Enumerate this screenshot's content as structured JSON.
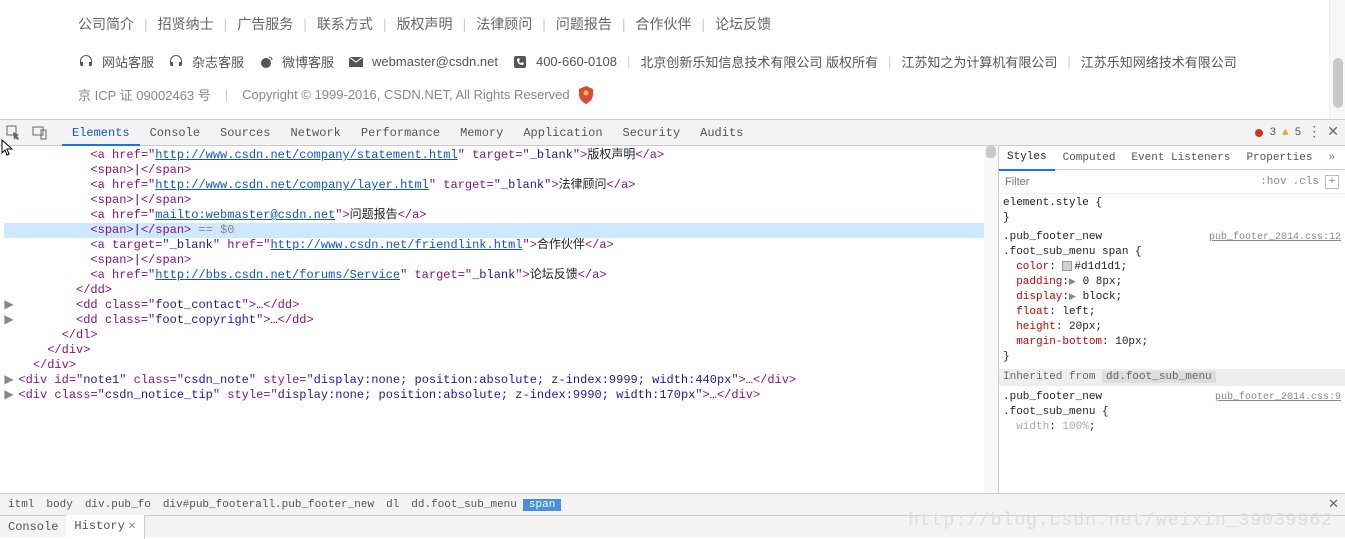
{
  "footer": {
    "links": [
      "公司简介",
      "招贤纳士",
      "广告服务",
      "联系方式",
      "版权声明",
      "法律顾问",
      "问题报告",
      "合作伙伴",
      "论坛反馈"
    ],
    "contacts": {
      "web_cs": "网站客服",
      "mag_cs": "杂志客服",
      "weibo_cs": "微博客服",
      "email": "webmaster@csdn.net",
      "phone": "400-660-0108",
      "co1": "北京创新乐知信息技术有限公司 版权所有",
      "co2": "江苏知之为计算机有限公司",
      "co3": "江苏乐知网络技术有限公司"
    },
    "copy": {
      "icp": "京 ICP 证 09002463 号",
      "text": "Copyright © 1999-2016, CSDN.NET, All Rights Reserved"
    }
  },
  "devtools": {
    "tabs": [
      "Elements",
      "Console",
      "Sources",
      "Network",
      "Performance",
      "Memory",
      "Application",
      "Security",
      "Audits"
    ],
    "active_tab": "Elements",
    "errors": "3",
    "warnings": "5",
    "styles_tabs": [
      "Styles",
      "Computed",
      "Event Listeners",
      "Properties"
    ],
    "styles_active": "Styles",
    "filter_placeholder": "Filter",
    "hov_label": ":hov",
    "cls_label": ".cls",
    "breadcrumb": [
      "itml",
      "body",
      "div.pub_fo",
      "div#pub_footerall.pub_footer_new",
      "dl",
      "dd.foot_sub_menu",
      "span"
    ],
    "breadcrumb_sel": 6,
    "drawer_tabs": [
      "Console",
      "History"
    ],
    "drawer_active": 1
  },
  "dom": {
    "l1": {
      "indent": "            ",
      "open": "<a href=\"",
      "href": "http://www.csdn.net/company/statement.html",
      "mid": "\" target=\"",
      "tgt": "_blank",
      "mid2": "\">",
      "txt": "版权声明",
      "close": "</a>"
    },
    "l2": {
      "indent": "            ",
      "open": "<span>",
      "txt": "|",
      "close": "</span>"
    },
    "l3": {
      "indent": "            ",
      "open": "<a href=\"",
      "href": "http://www.csdn.net/company/layer.html",
      "mid": "\" target=\"",
      "tgt": "_blank",
      "mid2": "\">",
      "txt": "法律顾问",
      "close": "</a>"
    },
    "l4": {
      "indent": "            ",
      "open": "<span>",
      "txt": "|",
      "close": "</span>"
    },
    "l5": {
      "indent": "            ",
      "open": "<a href=\"",
      "href": "mailto:webmaster@csdn.net",
      "mid": "\">",
      "txt": "问题报告",
      "close": "</a>"
    },
    "l6": {
      "indent": "            ",
      "open": "<span>",
      "txt": "|",
      "close": "</span>",
      "eq": " == $0"
    },
    "l7": {
      "indent": "            ",
      "open": "<a target=\"",
      "tgt": "_blank",
      "mid": "\" href=\"",
      "href": "http://www.csdn.net/friendlink.html",
      "mid2": "\">",
      "txt": "合作伙伴",
      "close": "</a>"
    },
    "l8": {
      "indent": "            ",
      "open": "<span>",
      "txt": "|",
      "close": "</span>"
    },
    "l9": {
      "indent": "            ",
      "open": "<a href=\"",
      "href": "http://bbs.csdn.net/forums/Service",
      "mid": "\" target=\"",
      "tgt": "_blank",
      "mid2": "\">",
      "txt": "论坛反馈",
      "close": "</a>"
    },
    "l10": {
      "indent": "          ",
      "txt": "</dd>"
    },
    "l11": {
      "indent": "          ",
      "open": "<dd class=\"",
      "cls": "foot_contact",
      "mid": "\">",
      "ell": "…",
      "close": "</dd>"
    },
    "l12": {
      "indent": "          ",
      "open": "<dd class=\"",
      "cls": "foot_copyright",
      "mid": "\">",
      "ell": "…",
      "close": "</dd>"
    },
    "l13": {
      "indent": "        ",
      "txt": "</dl>"
    },
    "l14": {
      "indent": "      ",
      "txt": "</div>"
    },
    "l15": {
      "indent": "    ",
      "txt": "</div>"
    },
    "l16": {
      "indent": "  ",
      "open": "<div id=\"",
      "id": "note1",
      "mid": "\" class=\"",
      "cls": "csdn_note",
      "mid2": "\" style=\"",
      "sty": "display:none; position:absolute; z-index:9999; width:440px",
      "mid3": "\">",
      "ell": "…",
      "close": "</div>"
    },
    "l17": {
      "indent": "  ",
      "open": "<div class=\"",
      "cls": "csdn_notice_tip",
      "mid": "\" style=\"",
      "sty": "display:none; position:absolute; z-index:9990; width:170px",
      "mid2": "\">",
      "ell": "…",
      "close": "</div>"
    }
  },
  "styles": {
    "r0": {
      "sel": "element.style",
      "body": ""
    },
    "r1": {
      "src": "pub_footer_2014.css:12",
      "sel1": ".pub_footer_new",
      "sel2": ".foot_sub_menu span",
      "props": [
        {
          "n": "color",
          "v": "#d1d1d1",
          "swatch": true
        },
        {
          "n": "padding",
          "v": "0 8px",
          "tri": true
        },
        {
          "n": "display",
          "v": "block",
          "tri": true
        },
        {
          "n": "float",
          "v": "left"
        },
        {
          "n": "height",
          "v": "20px"
        },
        {
          "n": "margin-bottom",
          "v": "10px"
        }
      ]
    },
    "inh": {
      "label": "Inherited from",
      "chip": "dd.foot_sub_menu"
    },
    "r2": {
      "src": "pub_footer_2014.css:9",
      "sel1": ".pub_footer_new",
      "sel2": ".foot_sub_menu",
      "props": [
        {
          "n": "width",
          "v": "100%",
          "struck": true
        }
      ]
    }
  },
  "watermark": "http://blog.csdn.net/weixin_39039962"
}
